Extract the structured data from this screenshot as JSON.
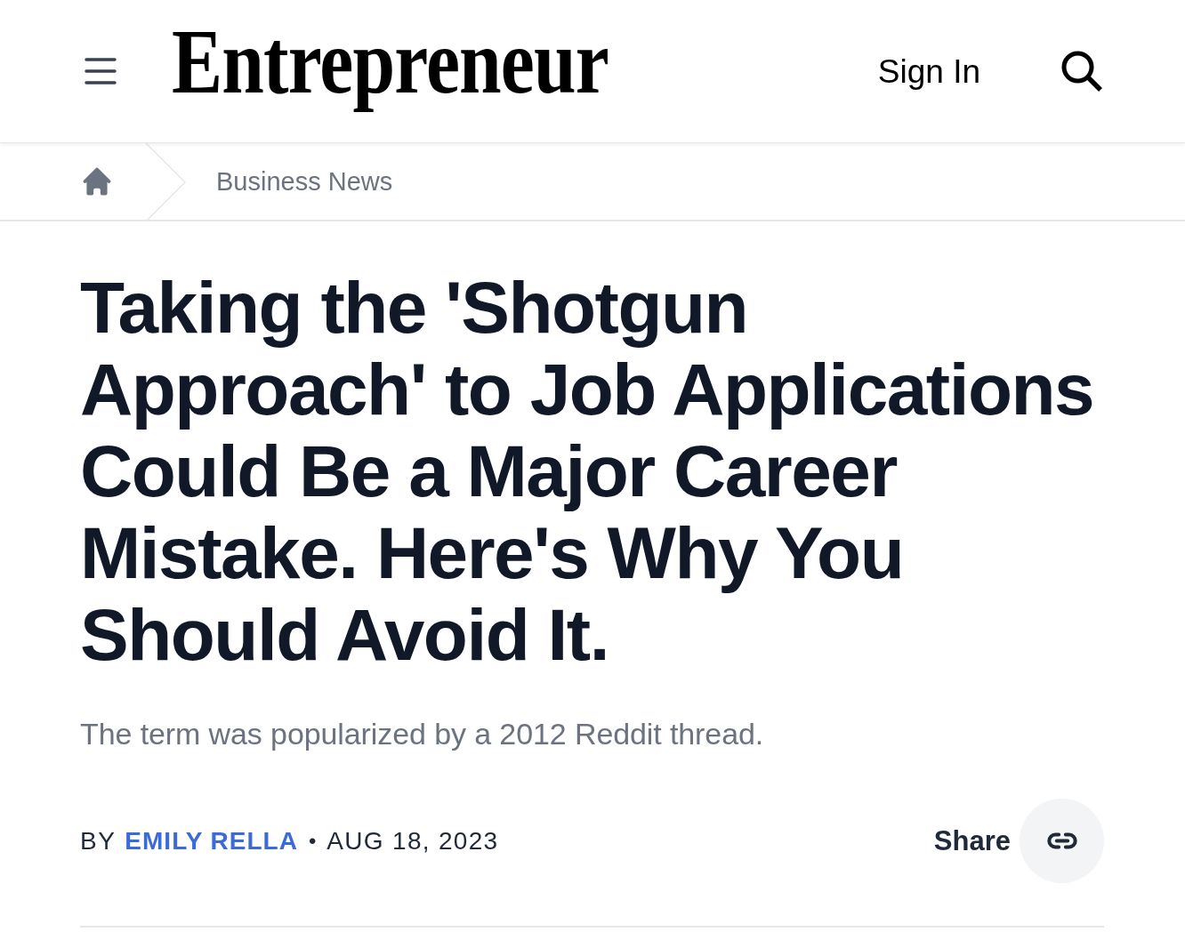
{
  "header": {
    "logo": "Entrepreneur",
    "sign_in": "Sign In"
  },
  "breadcrumb": {
    "section": "Business News"
  },
  "article": {
    "title": "Taking the 'Shotgun Approach' to Job Applications Could Be a Major Career Mistake. Here's Why You Should Avoid It.",
    "subtitle": "The term was popularized by a 2012 Reddit thread.",
    "byline": {
      "prefix": "BY",
      "author": "EMILY RELLA",
      "separator": "•",
      "date": "AUG 18, 2023"
    },
    "share": {
      "label": "Share"
    }
  }
}
